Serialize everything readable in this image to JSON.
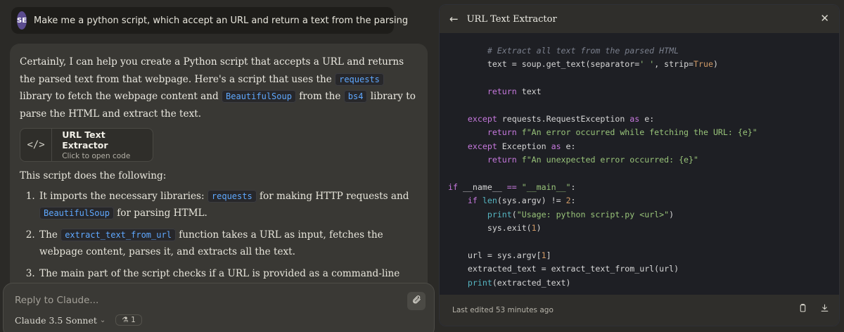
{
  "user": {
    "initials": "SE",
    "message": "Make me a python script, which accept an URL and return a text from the parsing"
  },
  "assistant": {
    "intro": [
      {
        "t": "text",
        "v": "Certainly, I can help you create a Python script that accepts a URL and returns the parsed text from that webpage. Here's a script that uses the "
      },
      {
        "t": "code",
        "v": "requests"
      },
      {
        "t": "text",
        "v": " library to fetch the webpage content and "
      },
      {
        "t": "code",
        "v": "BeautifulSoup"
      },
      {
        "t": "text",
        "v": " from the "
      },
      {
        "t": "code",
        "v": "bs4"
      },
      {
        "t": "text",
        "v": " library to parse the HTML and extract the text."
      }
    ],
    "artifact_card": {
      "icon": "</>",
      "title": "URL Text Extractor",
      "subtitle": "Click to open code"
    },
    "does_following": "This script does the following:",
    "steps": [
      [
        {
          "t": "text",
          "v": "It imports the necessary libraries: "
        },
        {
          "t": "code",
          "v": "requests"
        },
        {
          "t": "text",
          "v": " for making HTTP requests and "
        },
        {
          "t": "code",
          "v": "BeautifulSoup"
        },
        {
          "t": "text",
          "v": " for parsing HTML."
        }
      ],
      [
        {
          "t": "text",
          "v": "The "
        },
        {
          "t": "code",
          "v": "extract_text_from_url"
        },
        {
          "t": "text",
          "v": " function takes a URL as input, fetches the webpage content, parses it, and extracts all the text."
        }
      ],
      [
        {
          "t": "text",
          "v": "The main part of the script checks if a URL is provided as a command-line argument and calls the function with that URL."
        }
      ]
    ]
  },
  "reply": {
    "placeholder": "Reply to Claude...",
    "model": "Claude 3.5 Sonnet",
    "project_count": "1"
  },
  "artifact": {
    "back_icon": "←",
    "title": "URL Text Extractor",
    "close_icon": "✕",
    "footer": "Last edited 53 minutes ago",
    "code_lines": [
      [
        {
          "c": "plain",
          "v": "        "
        },
        {
          "c": "comment",
          "v": "# Extract all text from the parsed HTML"
        }
      ],
      [
        {
          "c": "plain",
          "v": "        text = soup.get_text(separator="
        },
        {
          "c": "str",
          "v": "' '"
        },
        {
          "c": "plain",
          "v": ", strip="
        },
        {
          "c": "num",
          "v": "True"
        },
        {
          "c": "plain",
          "v": ")"
        }
      ],
      [
        {
          "c": "plain",
          "v": ""
        }
      ],
      [
        {
          "c": "plain",
          "v": "        "
        },
        {
          "c": "kw",
          "v": "return"
        },
        {
          "c": "plain",
          "v": " text"
        }
      ],
      [
        {
          "c": "plain",
          "v": ""
        }
      ],
      [
        {
          "c": "plain",
          "v": "    "
        },
        {
          "c": "kw",
          "v": "except"
        },
        {
          "c": "plain",
          "v": " requests.RequestException "
        },
        {
          "c": "kw",
          "v": "as"
        },
        {
          "c": "plain",
          "v": " e:"
        }
      ],
      [
        {
          "c": "plain",
          "v": "        "
        },
        {
          "c": "kw",
          "v": "return"
        },
        {
          "c": "plain",
          "v": " "
        },
        {
          "c": "str",
          "v": "f\"An error occurred while fetching the URL: {e}\""
        }
      ],
      [
        {
          "c": "plain",
          "v": "    "
        },
        {
          "c": "kw",
          "v": "except"
        },
        {
          "c": "plain",
          "v": " Exception "
        },
        {
          "c": "kw",
          "v": "as"
        },
        {
          "c": "plain",
          "v": " e:"
        }
      ],
      [
        {
          "c": "plain",
          "v": "        "
        },
        {
          "c": "kw",
          "v": "return"
        },
        {
          "c": "plain",
          "v": " "
        },
        {
          "c": "str",
          "v": "f\"An unexpected error occurred: {e}\""
        }
      ],
      [
        {
          "c": "plain",
          "v": ""
        }
      ],
      [
        {
          "c": "kw",
          "v": "if"
        },
        {
          "c": "plain",
          "v": " __name__ "
        },
        {
          "c": "kw",
          "v": "=="
        },
        {
          "c": "plain",
          "v": " "
        },
        {
          "c": "str",
          "v": "\"__main__\""
        },
        {
          "c": "plain",
          "v": ":"
        }
      ],
      [
        {
          "c": "plain",
          "v": "    "
        },
        {
          "c": "kw",
          "v": "if"
        },
        {
          "c": "plain",
          "v": " "
        },
        {
          "c": "builtin",
          "v": "len"
        },
        {
          "c": "plain",
          "v": "(sys.argv) != "
        },
        {
          "c": "num",
          "v": "2"
        },
        {
          "c": "plain",
          "v": ":"
        }
      ],
      [
        {
          "c": "plain",
          "v": "        "
        },
        {
          "c": "builtin",
          "v": "print"
        },
        {
          "c": "plain",
          "v": "("
        },
        {
          "c": "str",
          "v": "\"Usage: python script.py <url>\""
        },
        {
          "c": "plain",
          "v": ")"
        }
      ],
      [
        {
          "c": "plain",
          "v": "        sys.exit("
        },
        {
          "c": "num",
          "v": "1"
        },
        {
          "c": "plain",
          "v": ")"
        }
      ],
      [
        {
          "c": "plain",
          "v": ""
        }
      ],
      [
        {
          "c": "plain",
          "v": "    url = sys.argv["
        },
        {
          "c": "num",
          "v": "1"
        },
        {
          "c": "plain",
          "v": "]"
        }
      ],
      [
        {
          "c": "plain",
          "v": "    extracted_text = extract_text_from_url(url)"
        }
      ],
      [
        {
          "c": "plain",
          "v": "    "
        },
        {
          "c": "builtin",
          "v": "print"
        },
        {
          "c": "plain",
          "v": "(extracted_text)"
        }
      ]
    ]
  }
}
